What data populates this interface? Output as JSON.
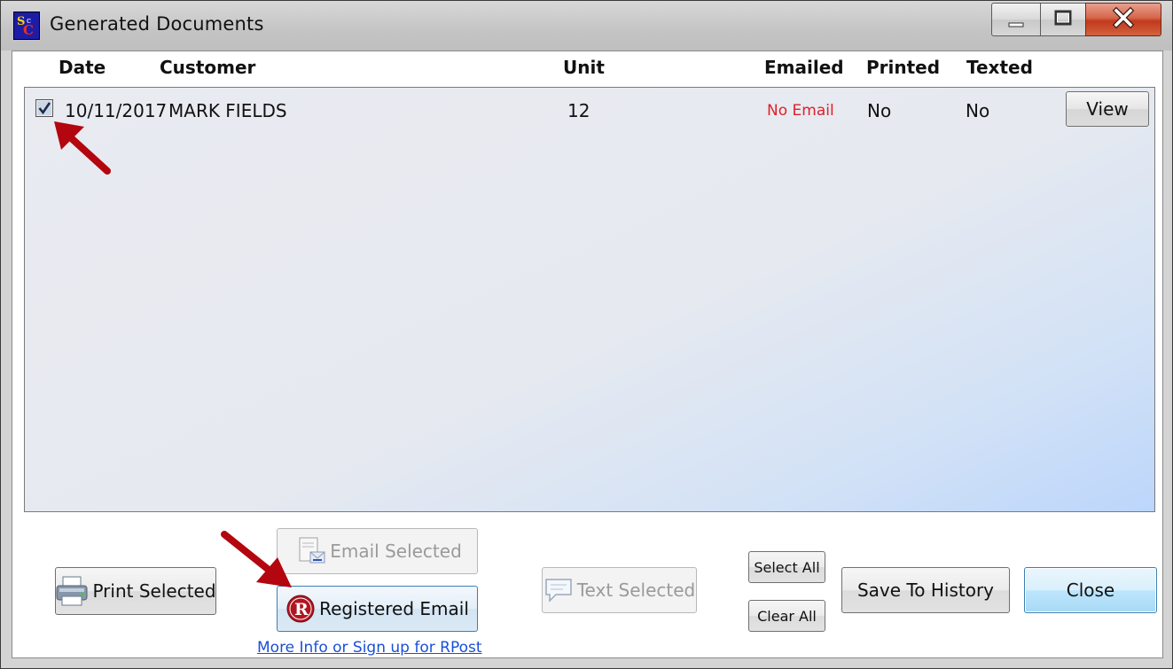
{
  "window": {
    "title": "Generated Documents",
    "app_icon": "app-logo-icon",
    "controls": {
      "minimize": "minimize-icon",
      "maximize": "maximize-icon",
      "close": "close-icon"
    }
  },
  "table": {
    "columns": {
      "date": "Date",
      "customer": "Customer",
      "unit": "Unit",
      "emailed": "Emailed",
      "printed": "Printed",
      "texted": "Texted"
    },
    "rows": [
      {
        "checked": true,
        "date": "10/11/2017",
        "customer": "MARK FIELDS",
        "unit": "12",
        "emailed": "No Email",
        "printed": "No",
        "texted": "No",
        "view_label": "View"
      }
    ]
  },
  "buttons": {
    "print_selected": "Print Selected",
    "email_selected": "Email Selected",
    "registered_email": "Registered Email",
    "text_selected": "Text Selected",
    "select_all": "Select All",
    "clear_all": "Clear All",
    "save_to_history": "Save To History",
    "close": "Close"
  },
  "rpost_link": "More Info or Sign up for RPost",
  "colors": {
    "no_email": "#e0202a",
    "link": "#1a4fd8",
    "annotation_arrow": "#b3060e",
    "focus_border": "#3c7fb1"
  }
}
